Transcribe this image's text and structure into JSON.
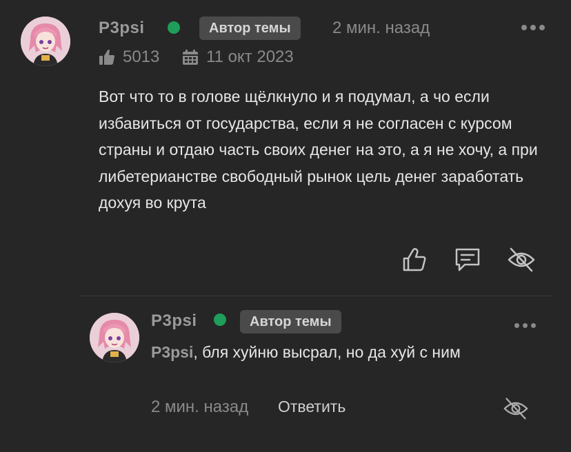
{
  "post": {
    "author": "P3psi",
    "badge": "Автор темы",
    "time": "2 мин. назад",
    "likes": "5013",
    "date": "11 окт 2023",
    "text": "Вот что то в голове щёлкнуло и я подумал, а чо если избавиться от государства, если я не согласен с курсом страны и отдаю часть своих денег на это, а я не хочу, а при либетерианстве свободный рынок цель денег заработать дохуя во крута"
  },
  "reply": {
    "author": "P3psi",
    "badge": "Автор темы",
    "mention": "P3psi",
    "text": ", бля хуйню высрал, но да хуй с ним",
    "time": "2 мин. назад",
    "reply_label": "Ответить"
  },
  "colors": {
    "background": "#262626",
    "online": "#1f9d5a",
    "badge_bg": "#4a4a4a"
  },
  "icons": {
    "like": "thumbs-up-icon",
    "comment": "comment-icon",
    "hide": "eye-slash-icon",
    "more": "more-dots-icon",
    "likes_stat": "thumbs-up-filled-icon",
    "date_stat": "calendar-icon"
  }
}
